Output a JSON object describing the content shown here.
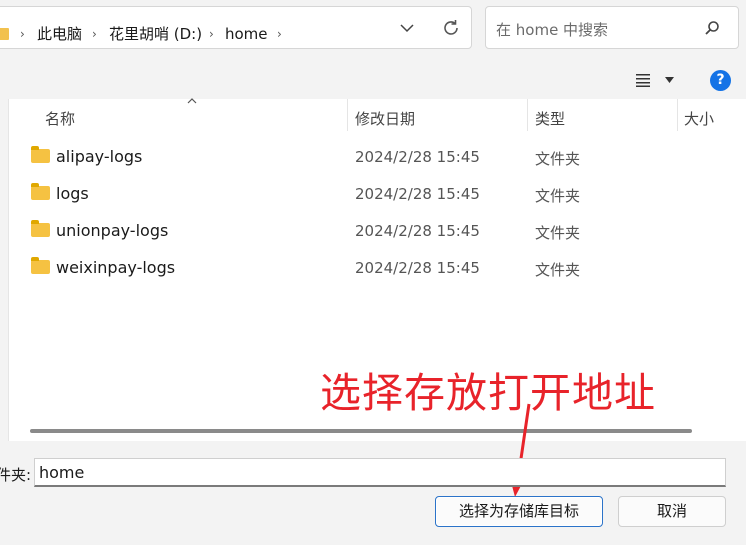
{
  "breadcrumb": {
    "items": [
      "此电脑",
      "花里胡哨 (D:)",
      "home"
    ],
    "chevron": "›"
  },
  "search": {
    "placeholder": "在 home 中搜索"
  },
  "columns": {
    "name": "名称",
    "modified": "修改日期",
    "type": "类型",
    "size": "大小"
  },
  "files": [
    {
      "name": "alipay-logs",
      "modified": "2024/2/28 15:45",
      "type": "文件夹"
    },
    {
      "name": "logs",
      "modified": "2024/2/28 15:45",
      "type": "文件夹"
    },
    {
      "name": "unionpay-logs",
      "modified": "2024/2/28 15:45",
      "type": "文件夹"
    },
    {
      "name": "weixinpay-logs",
      "modified": "2024/2/28 15:45",
      "type": "文件夹"
    }
  ],
  "annotation": {
    "text": "选择存放打开地址",
    "color": "#e8232a"
  },
  "folder_field": {
    "label": "件夹:",
    "value": "home"
  },
  "buttons": {
    "select": "选择为存储库目标",
    "cancel": "取消"
  },
  "help": {
    "label": "?"
  },
  "colors": {
    "accent": "#1473e6",
    "folder": "#f5c242"
  }
}
